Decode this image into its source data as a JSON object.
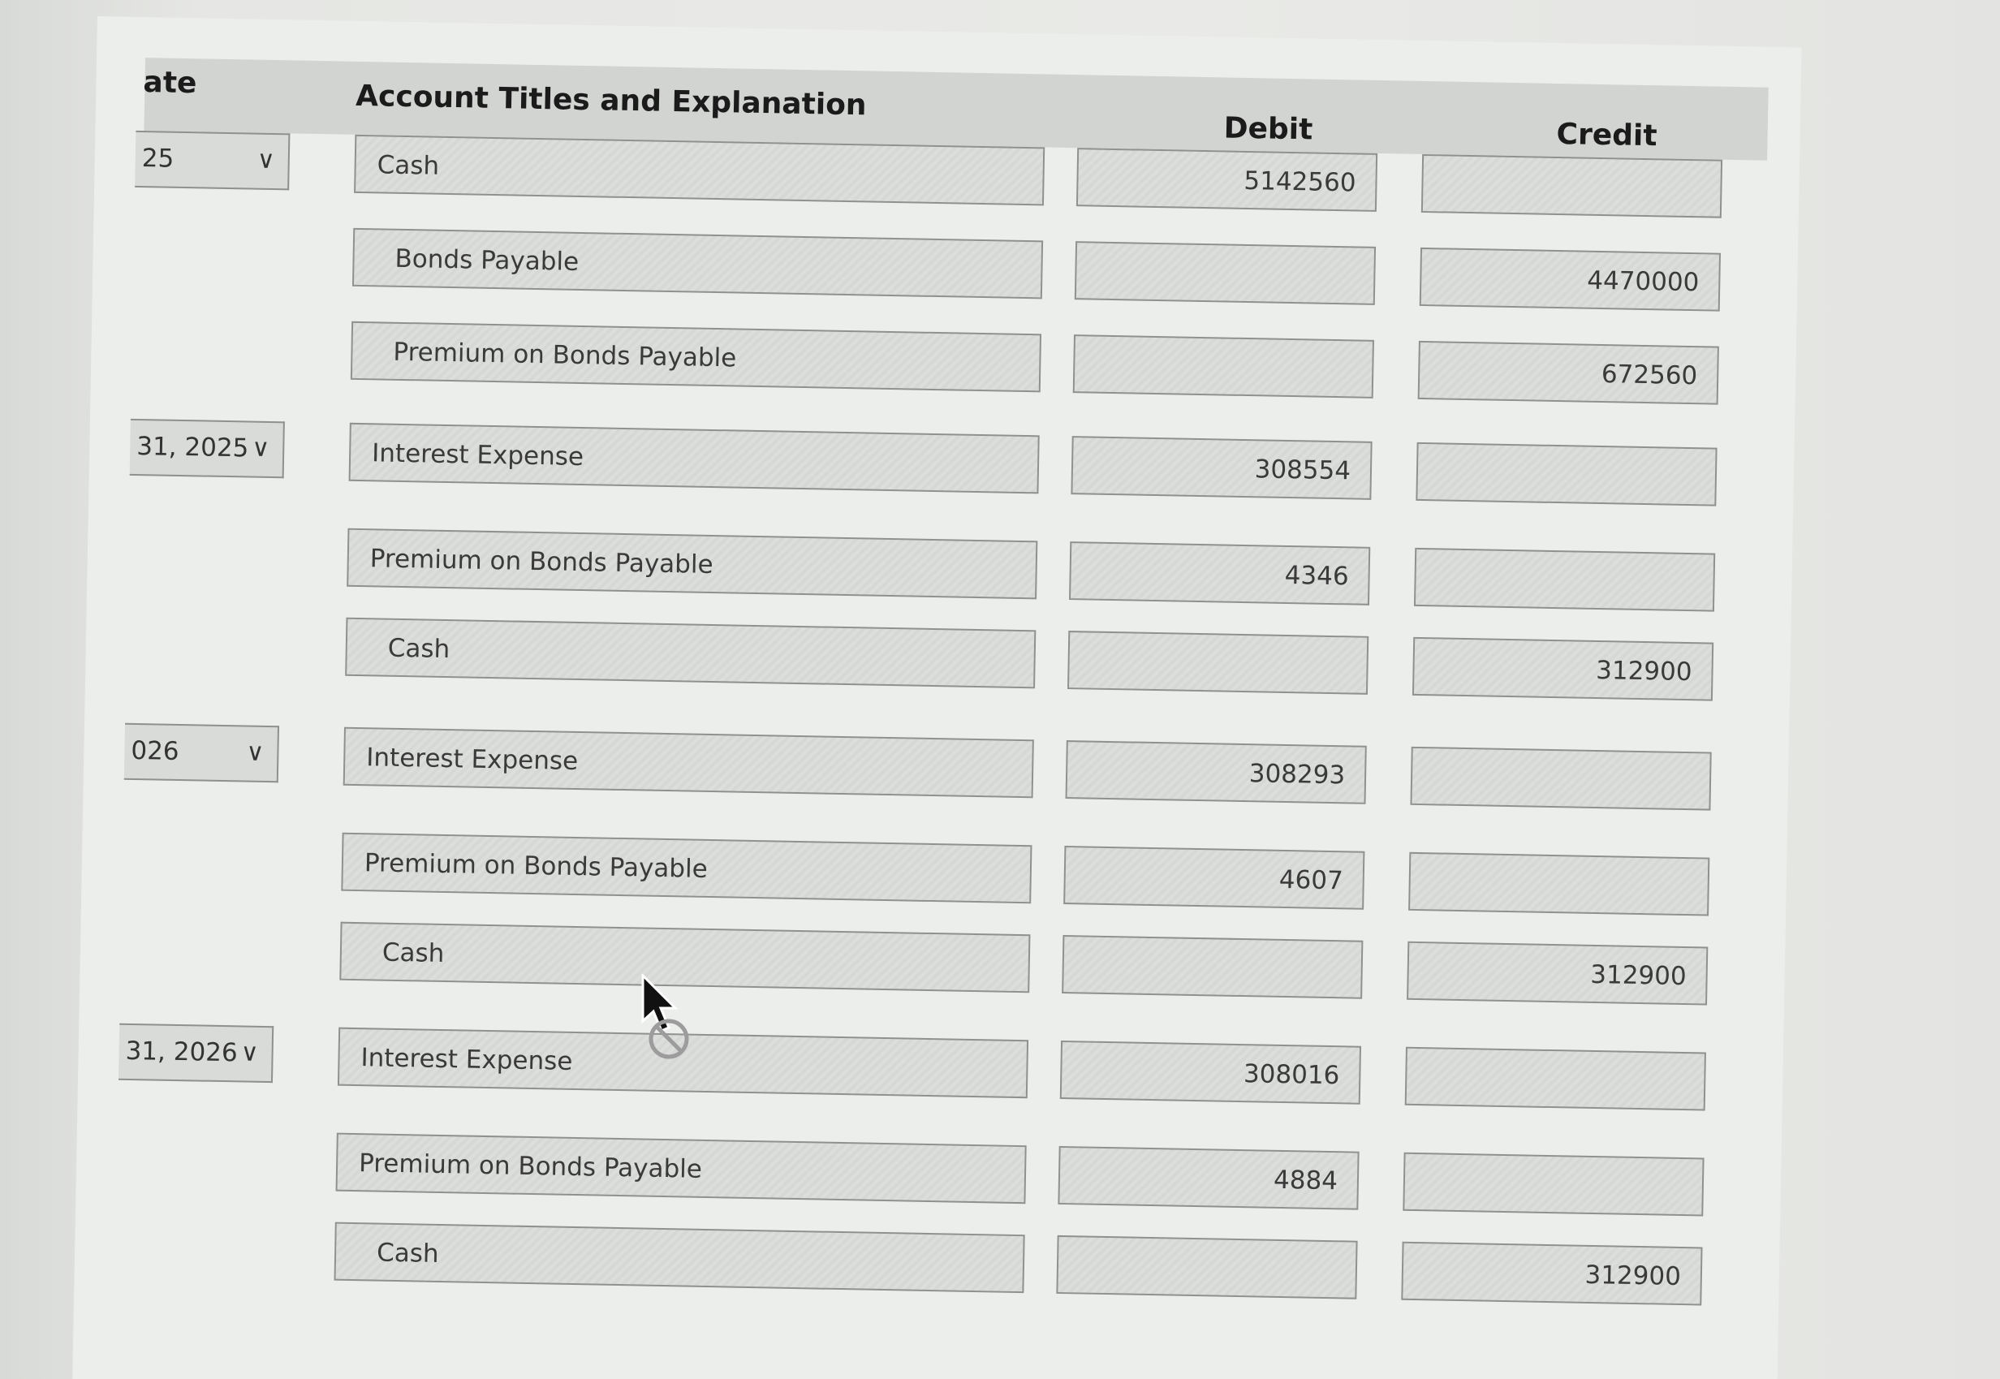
{
  "header": {
    "date": "ate",
    "account": "Account Titles and Explanation",
    "debit": "Debit",
    "credit": "Credit"
  },
  "rows": [
    {
      "date": "25",
      "account": "Cash",
      "indent": false,
      "debit": "5142560",
      "credit": ""
    },
    {
      "date": null,
      "account": "Bonds Payable",
      "indent": true,
      "debit": "",
      "credit": "4470000"
    },
    {
      "date": null,
      "account": "Premium on Bonds Payable",
      "indent": true,
      "debit": "",
      "credit": "672560"
    },
    {
      "date": "31, 2025",
      "account": "Interest Expense",
      "indent": false,
      "debit": "308554",
      "credit": ""
    },
    {
      "date": null,
      "account": "Premium on Bonds Payable",
      "indent": false,
      "debit": "4346",
      "credit": ""
    },
    {
      "date": null,
      "account": "Cash",
      "indent": true,
      "debit": "",
      "credit": "312900"
    },
    {
      "date": "026",
      "account": "Interest Expense",
      "indent": false,
      "debit": "308293",
      "credit": ""
    },
    {
      "date": null,
      "account": "Premium on Bonds Payable",
      "indent": false,
      "debit": "4607",
      "credit": ""
    },
    {
      "date": null,
      "account": "Cash",
      "indent": true,
      "debit": "",
      "credit": "312900"
    },
    {
      "date": "31, 2026",
      "account": "Interest Expense",
      "indent": false,
      "debit": "308016",
      "credit": ""
    },
    {
      "date": null,
      "account": "Premium on Bonds Payable",
      "indent": false,
      "debit": "4884",
      "credit": ""
    },
    {
      "date": null,
      "account": "Cash",
      "indent": true,
      "debit": "",
      "credit": "312900"
    }
  ],
  "icons": {
    "dropdown": "chevron-down-icon",
    "cursor": "mouse-pointer-icon"
  }
}
